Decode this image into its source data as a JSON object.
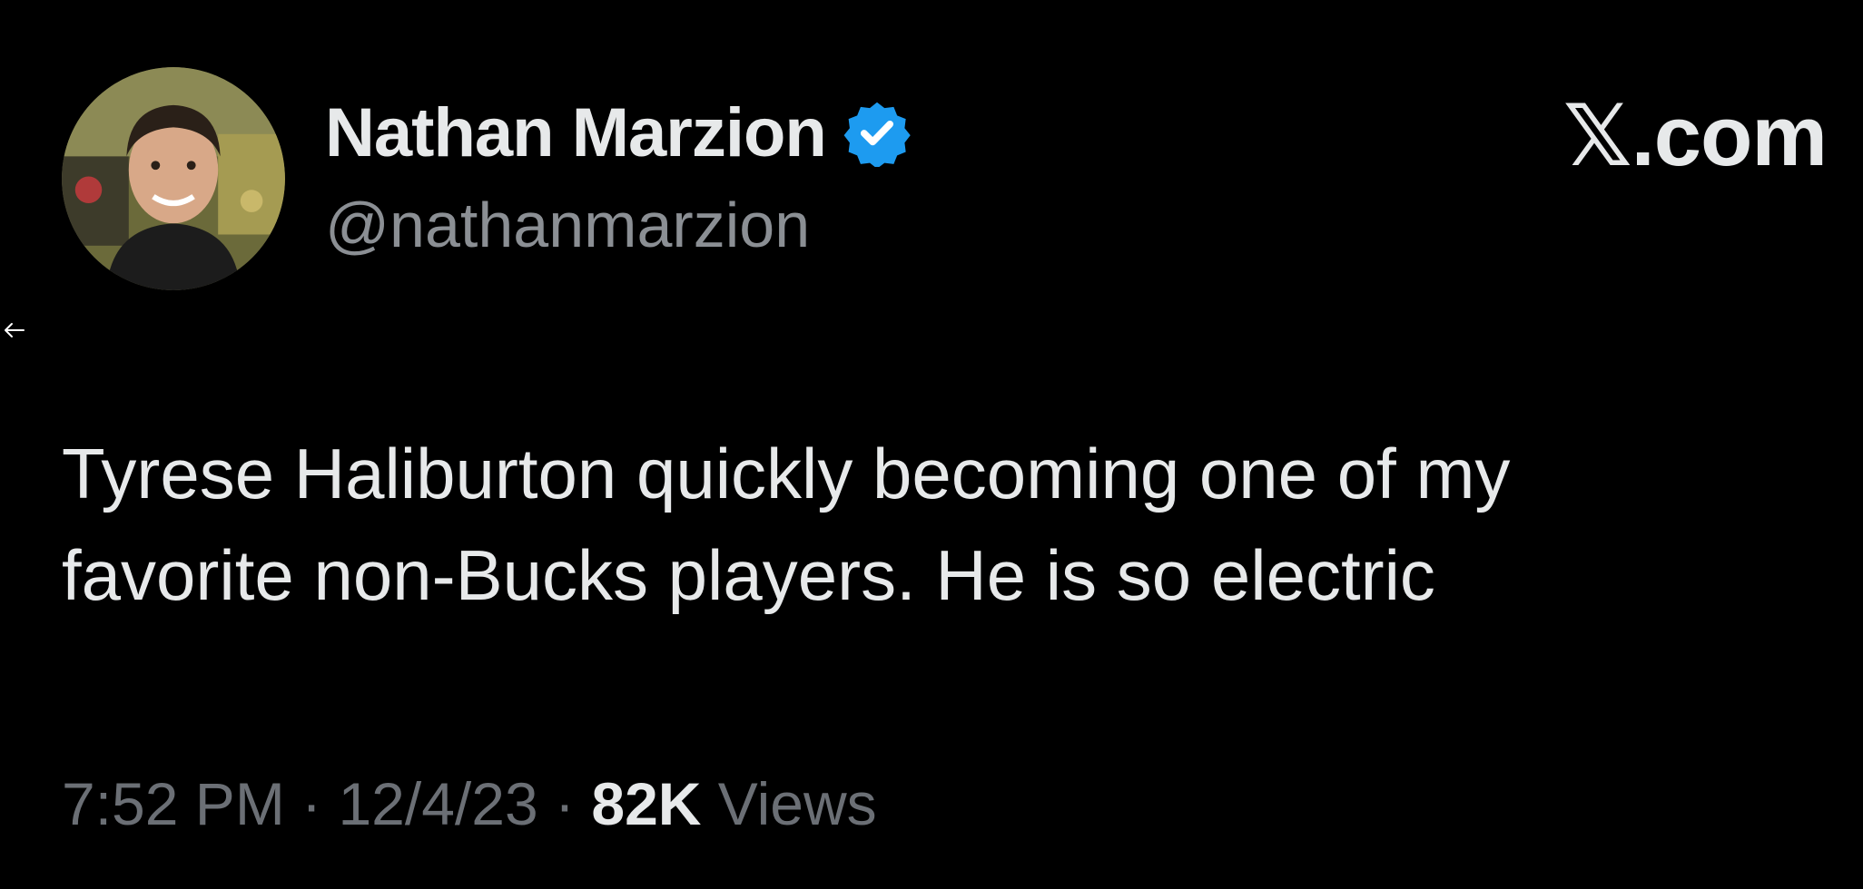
{
  "author": {
    "display_name": "Nathan Marzion",
    "handle": "@nathanmarzion",
    "verified_icon": "verified-badge-icon",
    "avatar_icon": "profile-photo"
  },
  "brand": {
    "label": "𝕏.com"
  },
  "tweet": {
    "line1": "Tyrese Haliburton quickly becoming one of my",
    "line2": "favorite non-Bucks players. He is so electric"
  },
  "meta": {
    "time": "7:52 PM",
    "separator": "·",
    "date": "12/4/23",
    "views_count": "82K",
    "views_label": "Views"
  },
  "colors": {
    "background": "#000000",
    "text_primary": "#e7e9ea",
    "text_secondary": "#6b6f75",
    "verified": "#1d9bf0"
  }
}
